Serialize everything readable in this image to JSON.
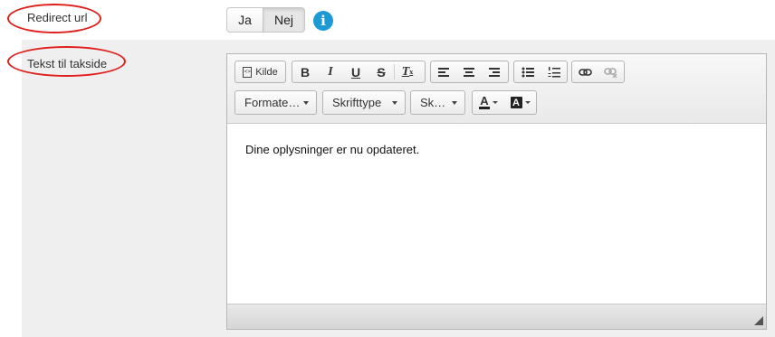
{
  "redirect": {
    "label": "Redirect url",
    "options": [
      "Ja",
      "Nej"
    ],
    "selected": "Nej",
    "info_icon": "info-icon"
  },
  "page_text": {
    "label": "Tekst til takside"
  },
  "editor": {
    "toolbar": {
      "source_label": "Kilde",
      "bold": "B",
      "italic": "I",
      "underline": "U",
      "strike": "S",
      "remove_format": "T",
      "format_combo": "Formate…",
      "font_combo": "Skrifttype",
      "size_combo": "Sk…",
      "text_color": "A",
      "bg_color": "A"
    },
    "content": "Dine oplysninger er nu opdateret."
  },
  "colors": {
    "annotation_red": "#e0201c",
    "info_blue": "#1d9ad6",
    "panel_bg": "#efefef"
  }
}
